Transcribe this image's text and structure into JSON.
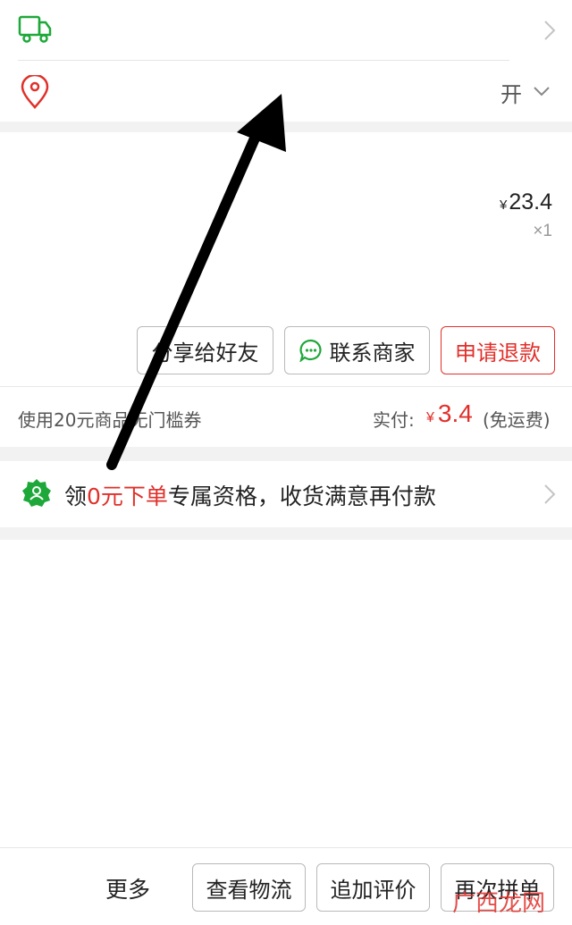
{
  "row_delivery": {
    "icon": "truck-icon"
  },
  "row_address": {
    "icon": "location-pin-icon",
    "trailing_text": "开"
  },
  "product": {
    "currency": "¥",
    "price": "23.4",
    "quantity": "×1"
  },
  "actions": {
    "share_label": "分享给好友",
    "contact_label": "联系商家",
    "refund_label": "申请退款"
  },
  "payment": {
    "coupon_text": "使用20元商品无门槛券",
    "paid_label": "实付:",
    "currency": "¥",
    "paid_amount": "3.4",
    "paid_note": "(免运费)"
  },
  "promo": {
    "prefix": "领",
    "highlight": "0元下单",
    "suffix": "专属资格，收货满意再付款",
    "icon": "badge-check-icon"
  },
  "bottom_bar": {
    "more_label": "更多",
    "logistics_label": "查看物流",
    "review_label": "追加评价",
    "reorder_label": "再次拼单"
  },
  "watermark": "广西龙网",
  "colors": {
    "accent_red": "#e0302b",
    "accent_green": "#1fa83a"
  }
}
